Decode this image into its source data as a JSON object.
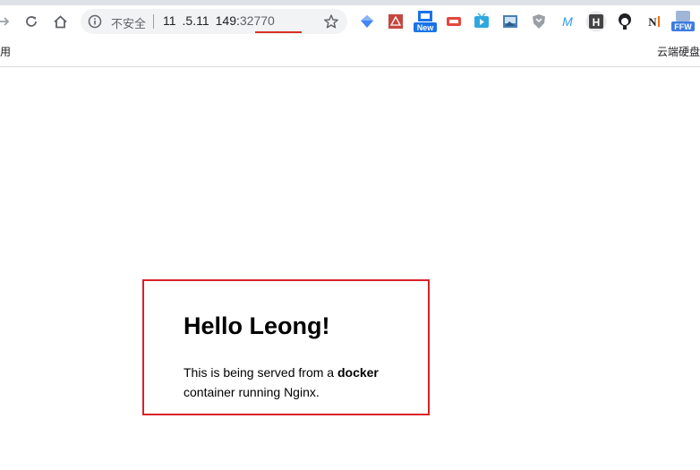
{
  "browser": {
    "security_label": "不安全",
    "url_host": "11 .5.11 149:",
    "url_port": "32770",
    "bookmark_left": "用",
    "bookmark_right": "云端硬盘",
    "extensions": [
      {
        "name": "diamond-extension-icon",
        "color": "#4285f4"
      },
      {
        "name": "pdf-extension-icon",
        "color": "#c5473f"
      },
      {
        "name": "new-extension-icon",
        "label": "New",
        "color": "#1a73e8"
      },
      {
        "name": "red-badge-extension-icon",
        "color": "#e8453c"
      },
      {
        "name": "tv-extension-icon",
        "color": "#2fa8e0"
      },
      {
        "name": "image-extension-icon",
        "color": "#4a7fb5"
      },
      {
        "name": "shield-extension-icon",
        "color": "#9aa0a6"
      },
      {
        "name": "m-extension-icon",
        "label": "M",
        "color": "#2f9ee8"
      },
      {
        "name": "h-extension-icon",
        "label": "H",
        "color": "#444444"
      },
      {
        "name": "avatar-extension-icon",
        "color": "#202124"
      },
      {
        "name": "n-extension-icon",
        "label": "N",
        "color": "#202124"
      },
      {
        "name": "ffw-extension-icon",
        "label": "FFW",
        "color": "#3d7be0"
      }
    ]
  },
  "page": {
    "heading": "Hello Leong!",
    "text_before": "This is being served from a ",
    "text_bold": "docker",
    "text_after": " container running Nginx."
  },
  "colors": {
    "annotation_red": "#d9222a",
    "toolbar_grey": "#dee1e6"
  }
}
